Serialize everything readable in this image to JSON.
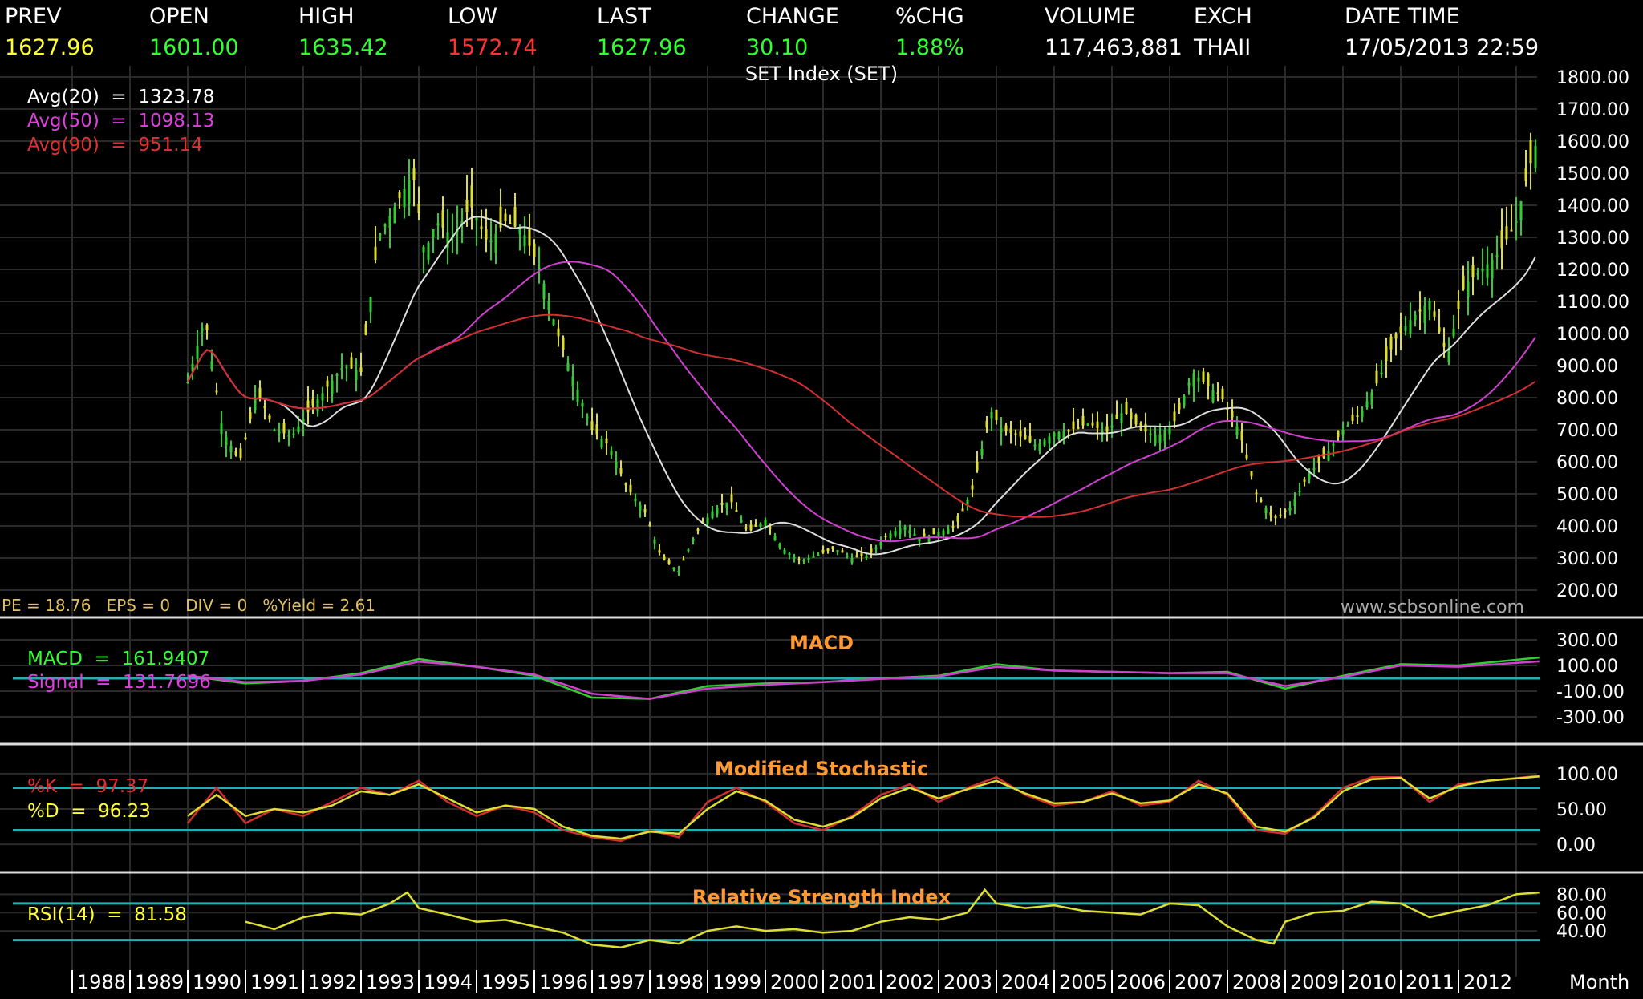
{
  "quote": {
    "labels": [
      "PREV",
      "OPEN",
      "HIGH",
      "LOW",
      "LAST",
      "CHANGE",
      "%CHG",
      "VOLUME",
      "EXCH",
      "DATE TIME"
    ],
    "values": [
      "1627.96",
      "1601.00",
      "1635.42",
      "1572.74",
      "1627.96",
      "30.10",
      "1.88%",
      "117,463,881",
      "THAII",
      "17/05/2013 22:59"
    ],
    "colors": [
      "#ffff33",
      "#33ff33",
      "#33ff33",
      "#ff3333",
      "#33ff33",
      "#33ff33",
      "#33ff33",
      "#ffffff",
      "#ffffff",
      "#ffffff"
    ]
  },
  "price_panel": {
    "title": "SET Index (SET)",
    "legend": [
      {
        "label": "Avg(20)",
        "value": "1323.78",
        "color": "#ffffff"
      },
      {
        "label": "Avg(50)",
        "value": "1098.13",
        "color": "#e040e0"
      },
      {
        "label": "Avg(90)",
        "value": "951.14",
        "color": "#e03030"
      }
    ],
    "fundamentals": "PE = 18.76   EPS = 0   DIV = 0   %Yield = 2.61",
    "watermark": "www.scbsonline.com"
  },
  "macd_panel": {
    "title": "MACD",
    "legend": [
      {
        "label": "MACD",
        "value": "161.9407",
        "color": "#33ff33"
      },
      {
        "label": "Signal",
        "value": "131.7696",
        "color": "#e040e0"
      }
    ]
  },
  "stoch_panel": {
    "title": "Modified Stochastic",
    "legend": [
      {
        "label": "%K",
        "value": "97.37",
        "color": "#e03030"
      },
      {
        "label": "%D",
        "value": "96.23",
        "color": "#ffff33"
      }
    ]
  },
  "rsi_panel": {
    "title": "Relative Strength Index",
    "legend": [
      {
        "label": "RSI(14)",
        "value": "81.58",
        "color": "#ffff33"
      }
    ]
  },
  "x_axis": {
    "years": [
      "1988",
      "1989",
      "1990",
      "1991",
      "1992",
      "1993",
      "1994",
      "1995",
      "1996",
      "1997",
      "1998",
      "1999",
      "2000",
      "2001",
      "2002",
      "2003",
      "2004",
      "2005",
      "2006",
      "2007",
      "2008",
      "2009",
      "2010",
      "2011",
      "2012"
    ],
    "unit": "Month"
  },
  "chart_data": [
    {
      "type": "candlestick",
      "title": "SET Index (SET)",
      "x_unit": "year",
      "ylim": [
        200,
        1800
      ],
      "yticks": [
        "1800.00",
        "1700.00",
        "1600.00",
        "1500.00",
        "1400.00",
        "1300.00",
        "1200.00",
        "1100.00",
        "1000.00",
        "900.00",
        "800.00",
        "700.00",
        "600.00",
        "500.00",
        "400.00",
        "300.00",
        "200.00"
      ],
      "close_series": {
        "x": [
          1990.0,
          1990.3,
          1990.6,
          1990.9,
          1991.2,
          1991.5,
          1991.8,
          1992.1,
          1992.4,
          1992.7,
          1993.0,
          1993.3,
          1993.6,
          1993.9,
          1994.1,
          1994.3,
          1994.6,
          1994.9,
          1995.2,
          1995.5,
          1995.8,
          1996.1,
          1996.4,
          1996.7,
          1997.0,
          1997.3,
          1997.6,
          1997.9,
          1998.2,
          1998.5,
          1998.8,
          1999.1,
          1999.4,
          1999.7,
          2000.0,
          2000.3,
          2000.6,
          2000.9,
          2001.2,
          2001.5,
          2001.8,
          2002.1,
          2002.4,
          2002.7,
          2003.0,
          2003.3,
          2003.6,
          2003.9,
          2004.1,
          2004.4,
          2004.7,
          2005.0,
          2005.3,
          2005.6,
          2005.9,
          2006.2,
          2006.5,
          2006.8,
          2007.1,
          2007.4,
          2007.7,
          2007.9,
          2008.2,
          2008.5,
          2008.8,
          2009.1,
          2009.4,
          2009.7,
          2010.0,
          2010.3,
          2010.6,
          2010.9,
          2011.2,
          2011.5,
          2011.8,
          2012.1,
          2012.4,
          2012.7,
          2013.0,
          2013.2,
          2013.4
        ],
        "close": [
          850,
          1050,
          700,
          600,
          820,
          700,
          680,
          760,
          830,
          900,
          880,
          1300,
          1400,
          1500,
          1250,
          1350,
          1300,
          1400,
          1280,
          1350,
          1320,
          1200,
          1000,
          850,
          700,
          650,
          520,
          450,
          300,
          260,
          380,
          450,
          480,
          380,
          420,
          330,
          290,
          310,
          330,
          300,
          310,
          370,
          400,
          360,
          380,
          400,
          520,
          760,
          700,
          680,
          650,
          690,
          700,
          720,
          690,
          760,
          700,
          680,
          730,
          880,
          830,
          800,
          700,
          500,
          420,
          460,
          560,
          620,
          700,
          750,
          850,
          980,
          1050,
          1100,
          930,
          1150,
          1200,
          1250,
          1350,
          1500,
          1628
        ]
      }
    },
    {
      "type": "line",
      "title": "MACD",
      "ylim": [
        -300,
        300
      ],
      "yticks": [
        "300.00",
        "100.00",
        "-100.00",
        "-300.00"
      ],
      "series": [
        {
          "name": "MACD",
          "x": [
            1990,
            1991,
            1992,
            1993,
            1994,
            1995,
            1996,
            1997,
            1998,
            1999,
            2000,
            2001,
            2002,
            2003,
            2004,
            2005,
            2006,
            2007,
            2008,
            2009,
            2010,
            2011,
            2012,
            2013.4
          ],
          "values": [
            20,
            -40,
            -20,
            40,
            150,
            90,
            20,
            -150,
            -160,
            -60,
            -40,
            -30,
            0,
            20,
            110,
            60,
            50,
            40,
            50,
            -80,
            20,
            110,
            100,
            162
          ]
        },
        {
          "name": "Signal",
          "x": [
            1990,
            1991,
            1992,
            1993,
            1994,
            1995,
            1996,
            1997,
            1998,
            1999,
            2000,
            2001,
            2002,
            2003,
            2004,
            2005,
            2006,
            2007,
            2008,
            2009,
            2010,
            2011,
            2012,
            2013.4
          ],
          "values": [
            20,
            -30,
            -20,
            30,
            130,
            90,
            30,
            -120,
            -160,
            -80,
            -50,
            -30,
            -5,
            15,
            90,
            60,
            50,
            40,
            40,
            -60,
            10,
            100,
            90,
            132
          ]
        }
      ]
    },
    {
      "type": "line",
      "title": "Modified Stochastic",
      "ylim": [
        -10,
        110
      ],
      "yticks": [
        "100.00",
        "50.00",
        "0.00"
      ],
      "series": [
        {
          "name": "%K",
          "x": [
            1990,
            1990.5,
            1991,
            1991.5,
            1992,
            1992.5,
            1993,
            1993.5,
            1994,
            1994.5,
            1995,
            1995.5,
            1996,
            1996.5,
            1997,
            1997.5,
            1998,
            1998.5,
            1999,
            1999.5,
            2000,
            2000.5,
            2001,
            2001.5,
            2002,
            2002.5,
            2003,
            2003.5,
            2004,
            2004.5,
            2005,
            2005.5,
            2006,
            2006.5,
            2007,
            2007.5,
            2008,
            2008.5,
            2009,
            2009.5,
            2010,
            2010.5,
            2011,
            2011.5,
            2012,
            2012.5,
            2013.4
          ],
          "values": [
            30,
            80,
            30,
            50,
            40,
            60,
            80,
            70,
            90,
            60,
            40,
            55,
            45,
            20,
            10,
            5,
            20,
            10,
            60,
            80,
            60,
            30,
            20,
            40,
            70,
            85,
            60,
            80,
            95,
            70,
            55,
            60,
            75,
            55,
            60,
            90,
            70,
            20,
            15,
            40,
            80,
            95,
            95,
            60,
            85,
            90,
            97
          ]
        },
        {
          "name": "%D",
          "x": [
            1990,
            1990.5,
            1991,
            1991.5,
            1992,
            1992.5,
            1993,
            1993.5,
            1994,
            1994.5,
            1995,
            1995.5,
            1996,
            1996.5,
            1997,
            1997.5,
            1998,
            1998.5,
            1999,
            1999.5,
            2000,
            2000.5,
            2001,
            2001.5,
            2002,
            2002.5,
            2003,
            2003.5,
            2004,
            2004.5,
            2005,
            2005.5,
            2006,
            2006.5,
            2007,
            2007.5,
            2008,
            2008.5,
            2009,
            2009.5,
            2010,
            2010.5,
            2011,
            2011.5,
            2012,
            2012.5,
            2013.4
          ],
          "values": [
            40,
            70,
            40,
            50,
            45,
            55,
            75,
            70,
            85,
            65,
            45,
            55,
            50,
            25,
            12,
            8,
            18,
            15,
            50,
            75,
            62,
            35,
            25,
            38,
            65,
            80,
            65,
            78,
            90,
            72,
            58,
            60,
            72,
            58,
            62,
            85,
            72,
            25,
            18,
            38,
            75,
            92,
            94,
            65,
            82,
            90,
            96
          ]
        }
      ]
    },
    {
      "type": "line",
      "title": "Relative Strength Index",
      "ylim": [
        20,
        90
      ],
      "yticks": [
        "80.00",
        "60.00",
        "40.00"
      ],
      "series": [
        {
          "name": "RSI(14)",
          "x": [
            1991,
            1991.5,
            1992,
            1992.5,
            1993,
            1993.5,
            1993.8,
            1994,
            1994.5,
            1995,
            1995.5,
            1996,
            1996.5,
            1997,
            1997.5,
            1998,
            1998.5,
            1999,
            1999.5,
            2000,
            2000.5,
            2001,
            2001.5,
            2002,
            2002.5,
            2003,
            2003.5,
            2003.8,
            2004,
            2004.5,
            2005,
            2005.5,
            2006,
            2006.5,
            2007,
            2007.5,
            2008,
            2008.5,
            2008.8,
            2009,
            2009.5,
            2010,
            2010.5,
            2011,
            2011.5,
            2012,
            2012.5,
            2013,
            2013.4
          ],
          "values": [
            50,
            42,
            55,
            60,
            58,
            70,
            82,
            65,
            58,
            50,
            52,
            45,
            38,
            25,
            22,
            30,
            26,
            40,
            45,
            40,
            42,
            38,
            40,
            50,
            55,
            52,
            60,
            85,
            70,
            65,
            68,
            62,
            60,
            58,
            70,
            68,
            45,
            30,
            26,
            50,
            60,
            62,
            72,
            70,
            55,
            62,
            68,
            80,
            82
          ]
        }
      ]
    }
  ]
}
